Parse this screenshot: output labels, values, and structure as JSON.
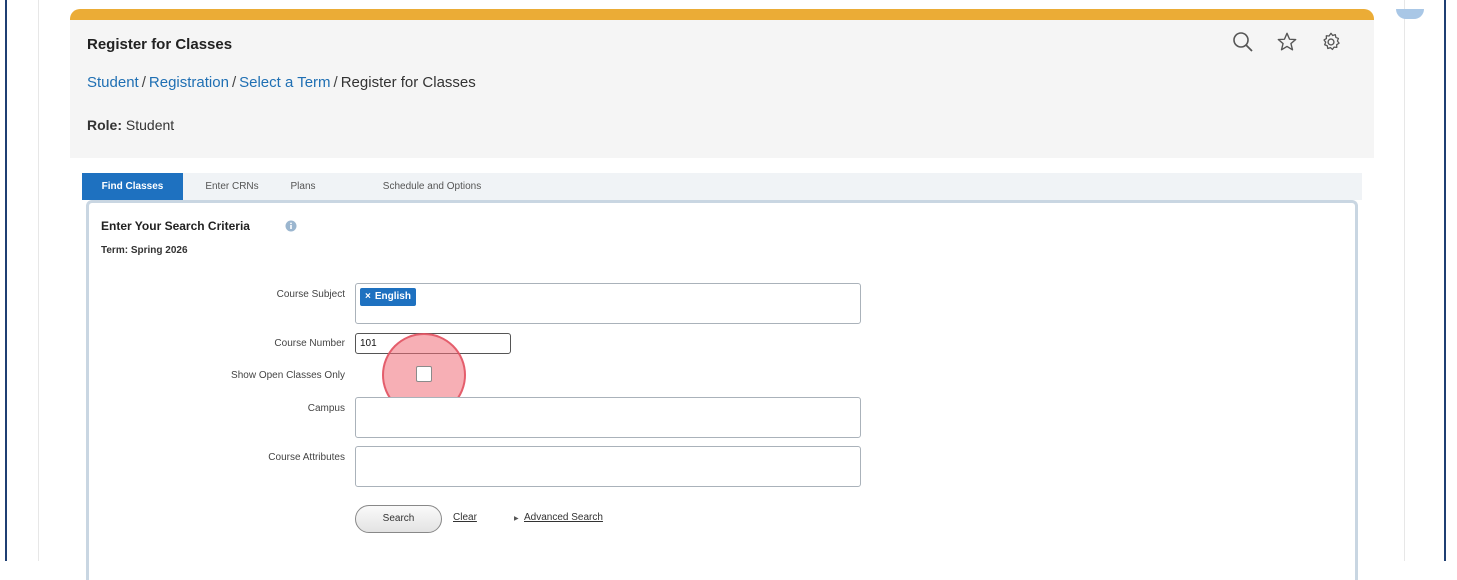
{
  "header": {
    "title": "Register for Classes",
    "breadcrumb": [
      "Student",
      "Registration",
      "Select a Term",
      "Register for Classes"
    ],
    "role_label": "Role:",
    "role_value": "Student",
    "icons": [
      "search-icon",
      "star-icon",
      "gear-icon"
    ]
  },
  "tabs": [
    {
      "label": "Find Classes",
      "active": true
    },
    {
      "label": "Enter CRNs",
      "active": false
    },
    {
      "label": "Plans",
      "active": false
    },
    {
      "label": "Schedule and Options",
      "active": false
    }
  ],
  "form": {
    "title": "Enter Your Search Criteria",
    "term": "Term: Spring 2026",
    "course_subject_label": "Course Subject",
    "course_subject_chips": [
      "English"
    ],
    "chip_remove": "×",
    "course_number_label": "Course Number",
    "course_number_value": "101",
    "open_only_label": "Show Open Classes Only",
    "open_only_checked": false,
    "campus_label": "Campus",
    "campus_value": "",
    "attributes_label": "Course Attributes",
    "attributes_value": "",
    "search_button": "Search",
    "clear_link": "Clear",
    "advanced_link": "Advanced Search"
  },
  "colors": {
    "accent_bar": "#ebac36",
    "tab_active": "#1e71c0",
    "link": "#1f6fb3",
    "frame_border": "#1f3f73",
    "click_highlight": "#f06e78"
  }
}
